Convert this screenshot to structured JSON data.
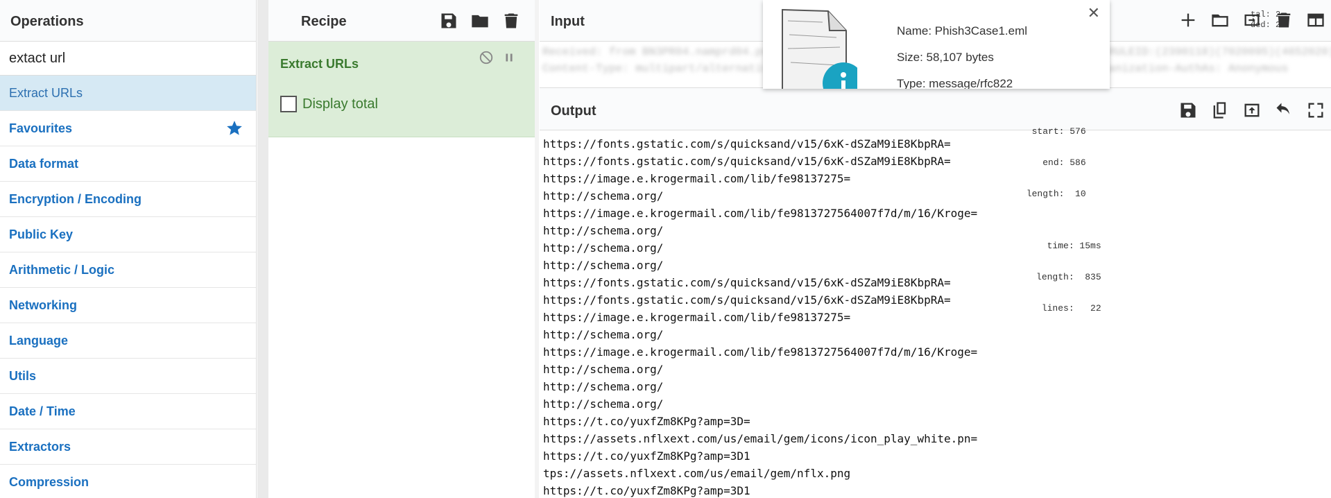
{
  "operations": {
    "title": "Operations",
    "search_value": "extact url",
    "items": [
      {
        "label": "Extract URLs"
      },
      {
        "label": "Favourites"
      },
      {
        "label": "Data format"
      },
      {
        "label": "Encryption / Encoding"
      },
      {
        "label": "Public Key"
      },
      {
        "label": "Arithmetic / Logic"
      },
      {
        "label": "Networking"
      },
      {
        "label": "Language"
      },
      {
        "label": "Utils"
      },
      {
        "label": "Date / Time"
      },
      {
        "label": "Extractors"
      },
      {
        "label": "Compression"
      }
    ]
  },
  "recipe": {
    "title": "Recipe",
    "operation": {
      "name": "Extract URLs",
      "option_label": "Display total"
    }
  },
  "input": {
    "title": "Input",
    "stats": {
      "total": "tal:  2",
      "loaded": "ded:  2"
    }
  },
  "file_popup": {
    "name": "Name: Phish3Case1.eml",
    "size": "Size: 58,107 bytes",
    "type": "Type: message/rfc822"
  },
  "output": {
    "title": "Output",
    "stats": {
      "start": "start: 576",
      "end": "end: 586",
      "length_sel": "length:  10",
      "time": "time: 15ms",
      "length": "length:  835",
      "lines": "lines:   22"
    },
    "lines": [
      "https://fonts.gstatic.com/s/quicksand/v15/6xK-dSZaM9iE8KbpRA=",
      "https://fonts.gstatic.com/s/quicksand/v15/6xK-dSZaM9iE8KbpRA=",
      "https://image.e.krogermail.com/lib/fe98137275=",
      "http://schema.org/",
      "https://image.e.krogermail.com/lib/fe9813727564007f7d/m/16/Kroge=",
      "http://schema.org/",
      "http://schema.org/",
      "http://schema.org/",
      "https://fonts.gstatic.com/s/quicksand/v15/6xK-dSZaM9iE8KbpRA=",
      "https://fonts.gstatic.com/s/quicksand/v15/6xK-dSZaM9iE8KbpRA=",
      "https://image.e.krogermail.com/lib/fe98137275=",
      "http://schema.org/",
      "https://image.e.krogermail.com/lib/fe9813727564007f7d/m/16/Kroge=",
      "http://schema.org/",
      "http://schema.org/",
      "http://schema.org/",
      "https://t.co/yuxfZm8KPg?amp=3D=",
      "https://assets.nflxext.com/us/email/gem/icons/icon_play_white.pn=",
      "https://t.co/yuxfZm8KPg?amp=3D1",
      "tps://assets.nflxext.com/us/email/gem/nflx.png",
      "https://t.co/yuxfZm8KPg?amp=3D1"
    ]
  },
  "colors": {
    "accent_blue": "#1a70c0",
    "selected_bg": "#d6e9f4",
    "recipe_green_bg": "#dcedd8",
    "recipe_green_text": "#3a7a2e"
  }
}
